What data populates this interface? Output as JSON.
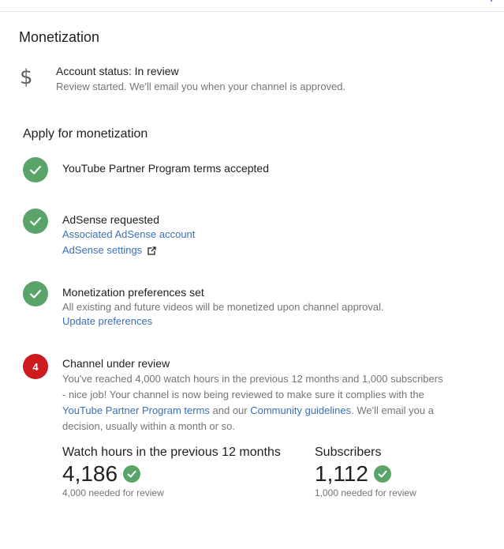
{
  "page_title": "Monetization",
  "account": {
    "icon": "dollar-icon",
    "status": "Account status: In review",
    "subtext": "Review started. We'll email you when your channel is approved."
  },
  "apply": {
    "title": "Apply for monetization",
    "steps": [
      {
        "badge": "check",
        "title": "YouTube Partner Program terms accepted"
      },
      {
        "badge": "check",
        "title": "AdSense requested",
        "links": [
          "Associated AdSense account",
          "AdSense settings"
        ]
      },
      {
        "badge": "check",
        "title": "Monetization preferences set",
        "text": "All existing and future videos will be monetized upon channel approval.",
        "links": [
          "Update preferences"
        ]
      },
      {
        "badge": "4",
        "title": "Channel under review",
        "text_part1": "You've reached 4,000 watch hours in the previous 12 months and 1,000 subscribers - nice job! Your channel is now being reviewed to make sure it complies with the ",
        "link1": "YouTube Partner Program terms",
        "text_part2": " and our ",
        "link2": "Community guidelines",
        "text_part3": ". We'll email you a decision, usually within a month or so."
      }
    ]
  },
  "stats": {
    "watch_hours": {
      "label": "Watch hours in the previous 12 months",
      "value": "4,186",
      "note": "4,000 needed for review"
    },
    "subscribers": {
      "label": "Subscribers",
      "value": "1,112",
      "note": "1,000 needed for review"
    }
  },
  "colors": {
    "check_green": "#5aa46a",
    "step_red": "#cc1a1f",
    "link_blue": "#3b6fb6"
  }
}
